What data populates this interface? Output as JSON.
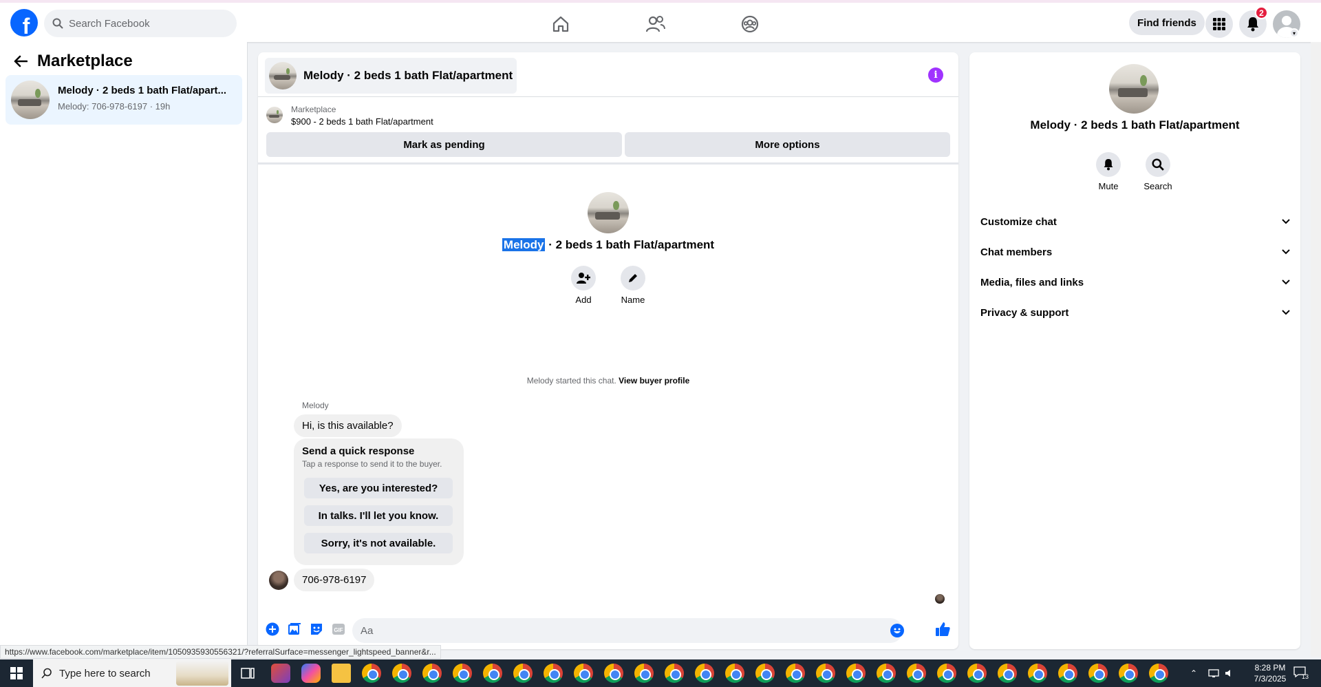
{
  "topbar": {
    "search_placeholder": "Search Facebook",
    "find_friends_label": "Find friends",
    "notification_count": "2",
    "logo_glyph": "f"
  },
  "left": {
    "title": "Marketplace",
    "conversation": {
      "title": "Melody · 2 beds 1 bath Flat/apart...",
      "subtitle": "Melody: 706-978-6197 · 19h"
    }
  },
  "chat": {
    "header_title": "Melody · 2 beds 1 bath Flat/apartment",
    "info_glyph": "i",
    "marketplace_label": "Marketplace",
    "listing_text": "$900 - 2 beds 1 bath Flat/apartment",
    "mark_pending_label": "Mark as pending",
    "more_options_label": "More options",
    "center_title_highlight": "Melody",
    "center_title_rest": " · 2 beds 1 bath Flat/apartment",
    "add_label": "Add",
    "name_label": "Name",
    "system_message": "Melody started this chat. ",
    "view_buyer_profile": "View buyer profile",
    "sender_name": "Melody",
    "message_1": "Hi, is this available?",
    "quick_response": {
      "title": "Send a quick response",
      "subtitle": "Tap a response to send it to the buyer.",
      "options": [
        "Yes, are you interested?",
        "In talks. I'll let you know.",
        "Sorry, it's not available."
      ]
    },
    "message_2": "706-978-6197",
    "composer_placeholder": "Aa"
  },
  "right": {
    "title": "Melody · 2 beds 1 bath Flat/apartment",
    "mute_label": "Mute",
    "search_label": "Search",
    "sections": [
      "Customize chat",
      "Chat members",
      "Media, files and links",
      "Privacy & support"
    ]
  },
  "status_url": "https://www.facebook.com/marketplace/item/1050935930556321/?referralSurface=messenger_lightspeed_banner&r...",
  "taskbar": {
    "search_placeholder": "Type here to search",
    "time": "8:28 PM",
    "date": "7/3/2025",
    "notification_count": "13"
  },
  "colors": {
    "brand_blue": "#0866ff",
    "info_purple": "#a033ff",
    "badge_red": "#e41e3f",
    "highlight_blue": "#1a73e8"
  }
}
